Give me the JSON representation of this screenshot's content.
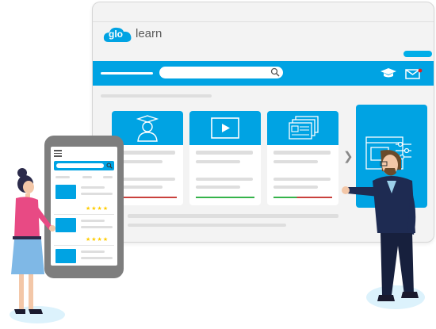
{
  "logo": {
    "mark": "glo",
    "word": "learn"
  },
  "colors": {
    "primary": "#00a3e3",
    "star": "#ffcc00",
    "alert": "#e02020",
    "progress_red": "#c9413d",
    "progress_green": "#35b34a"
  },
  "icons": [
    "graduation-cap-icon",
    "mail-icon",
    "search-icon",
    "student-icon",
    "video-play-icon",
    "documents-icon",
    "chevron-right-icon",
    "menu-icon"
  ],
  "phone": {
    "stars": "★★★★"
  }
}
